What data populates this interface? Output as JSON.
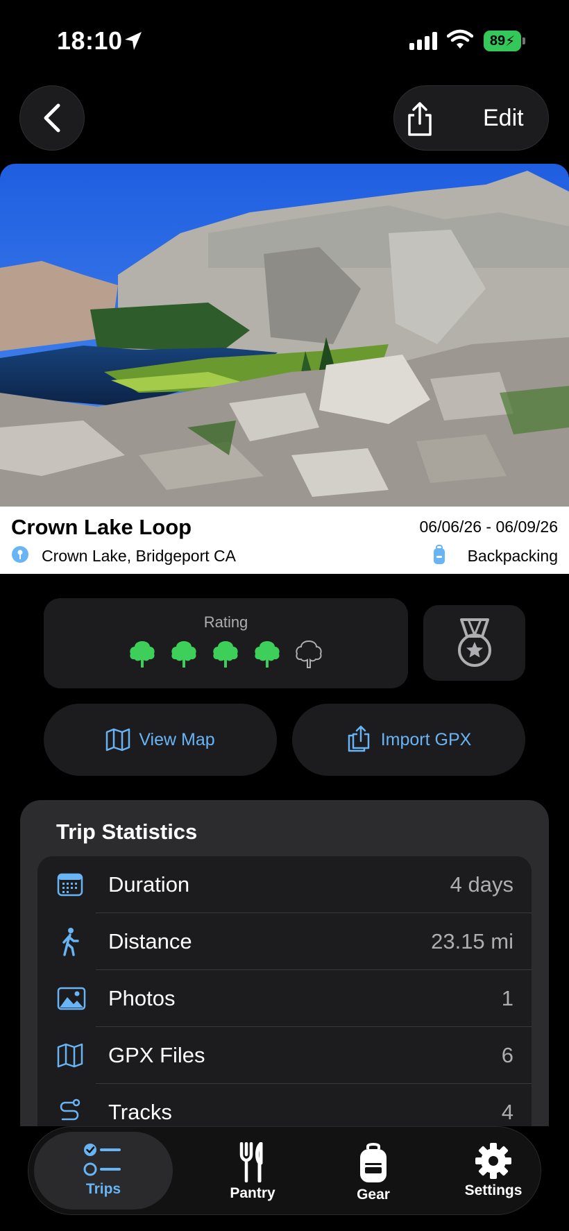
{
  "status_bar": {
    "time": "18:10",
    "battery": "89"
  },
  "nav": {
    "edit_label": "Edit"
  },
  "trip": {
    "title": "Crown Lake Loop",
    "dates": "06/06/26 - 06/09/26",
    "location": "Crown Lake, Bridgeport CA",
    "type": "Backpacking"
  },
  "rating": {
    "label": "Rating",
    "value": 4,
    "max": 5
  },
  "actions": {
    "view_map": "View Map",
    "import_gpx": "Import GPX"
  },
  "stats": {
    "title": "Trip Statistics",
    "rows": [
      {
        "label": "Duration",
        "value": "4 days",
        "icon": "calendar-icon"
      },
      {
        "label": "Distance",
        "value": "23.15 mi",
        "icon": "hiker-icon"
      },
      {
        "label": "Photos",
        "value": "1",
        "icon": "photo-icon"
      },
      {
        "label": "GPX Files",
        "value": "6",
        "icon": "map-icon"
      },
      {
        "label": "Tracks",
        "value": "4",
        "icon": "path-icon"
      }
    ]
  },
  "tabs": [
    {
      "label": "Trips",
      "active": true
    },
    {
      "label": "Pantry"
    },
    {
      "label": "Gear"
    },
    {
      "label": "Settings"
    }
  ],
  "colors": {
    "accent": "#69b4f5",
    "tree_filled": "#3ecf5a",
    "battery": "#34c759"
  }
}
